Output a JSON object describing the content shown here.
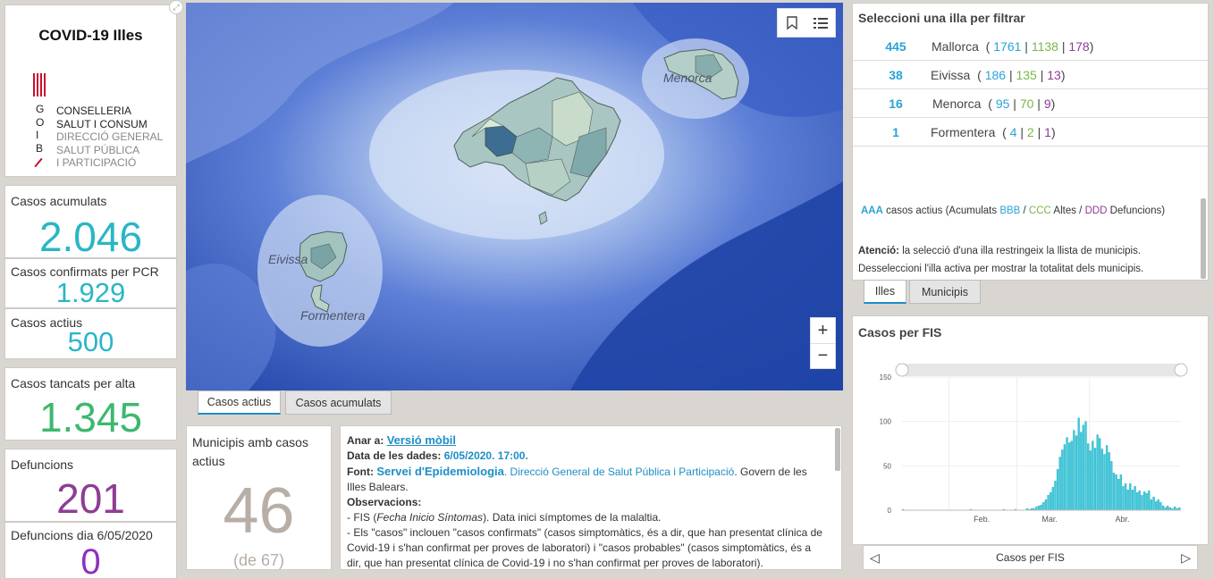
{
  "logo": {
    "title": "COVID-19 Illes",
    "letters": [
      "G",
      "O",
      "I",
      "B"
    ],
    "lines": [
      "CONSELLERIA",
      "SALUT I CONSUM",
      "DIRECCIÓ GENERAL",
      "SALUT PÚBLICA",
      "I PARTICIPACIÓ"
    ]
  },
  "kpis": {
    "acumulats": {
      "label": "Casos acumulats",
      "value": "2.046",
      "color": "#29b6c6"
    },
    "pcr": {
      "label": "Casos confirmats per PCR",
      "value": "1.929",
      "color": "#29b6c6"
    },
    "actius": {
      "label": "Casos actius",
      "value": "500",
      "color": "#29b6c6"
    },
    "alta": {
      "label": "Casos tancats per alta",
      "value": "1.345",
      "color": "#3db86e"
    },
    "defuncions": {
      "label": "Defuncions",
      "value": "201",
      "color": "#8e3d94"
    },
    "defuncions_dia": {
      "label": "Defuncions dia 6/05/2020",
      "value": "0",
      "color": "#8e2fc1"
    }
  },
  "map": {
    "labels": {
      "menorca": "Menorca",
      "eivissa": "Eivissa",
      "formentera": "Formentera"
    },
    "tools": {
      "bookmark_icon": "bookmark-icon",
      "legend_icon": "legend-list-icon"
    },
    "zoom_in": "+",
    "zoom_out": "−"
  },
  "map_tabs": {
    "active": "Casos actius",
    "inactive": "Casos acumulats"
  },
  "municipis": {
    "title": "Municipis amb casos actius",
    "value": "46",
    "sub": "(de 67)"
  },
  "info": {
    "anar_label": "Anar a:",
    "anar_link": "Versió mòbil",
    "data_label": "Data de les dades:",
    "data_value": "6/05/2020. 17:00.",
    "font_label": "Font:",
    "font_link": "Servei d'Epidemiologia",
    "font_rest_blue": ". Direcció General de Salut Pública i Participació",
    "font_rest": ". Govern de les Illes Balears.",
    "obs_label": "Observacions:",
    "obs_1a": "- FIS (",
    "obs_1b": "Fecha Inicio Síntomas",
    "obs_1c": "). Data inici símptomes de la malaltia.",
    "obs_2": "- Els \"casos\" inclouen \"casos confirmats\" (casos simptomàtics, és a dir, que han presentat clínica de Covid-19 i s'han confirmat per proves de laboratori) i \"casos probables\" (casos simptomàtics, és a dir, que han presentat clínica de Covid-19 i no s'han confirmat per proves de laboratori)."
  },
  "illes": {
    "title": "Seleccioni una illa per filtrar",
    "rows": [
      {
        "actius": "445",
        "name": "Mallorca",
        "acum": "1761",
        "altes": "1138",
        "def": "178"
      },
      {
        "actius": "38",
        "name": "Eivissa",
        "acum": "186",
        "altes": "135",
        "def": "13"
      },
      {
        "actius": "16",
        "name": "Menorca",
        "acum": "95",
        "altes": "70",
        "def": "9"
      },
      {
        "actius": "1",
        "name": "Formentera",
        "acum": "4",
        "altes": "2",
        "def": "1"
      }
    ],
    "legend": {
      "aaa": "AAA",
      "t1": " casos actius (Acumulats ",
      "bbb": "BBB",
      "t2": " / ",
      "ccc": "CCC",
      "t3": " Altes / ",
      "ddd": "DDD",
      "t4": " Defuncions)"
    },
    "atencio_label": "Atenció:",
    "atencio_text": " la selecció d'una illa restringeix la llista de municipis.",
    "atencio_text2": "Desseleccioni l'illa activa per mostrar la totalitat dels municipis."
  },
  "list_tabs": {
    "active": "Illes",
    "inactive": "Municipis"
  },
  "fis": {
    "title": "Casos per FIS",
    "footer": "Casos per FIS"
  },
  "chart_data": {
    "type": "bar",
    "title": "Casos per FIS",
    "ylim": [
      0,
      150
    ],
    "yticks": [
      0,
      50,
      100,
      150
    ],
    "xticks": [
      "Feb.",
      "Mar.",
      "Abr."
    ],
    "x_start": "2020-01-12",
    "color": "#3ec9dc",
    "values": [
      1,
      0,
      0,
      0,
      0,
      0,
      0,
      0,
      0,
      0,
      0,
      0,
      0,
      0,
      0,
      0,
      0,
      0,
      0,
      0,
      0,
      0,
      0,
      0,
      0,
      0,
      0,
      0,
      0,
      1,
      0,
      0,
      0,
      0,
      0,
      0,
      0,
      0,
      0,
      0,
      0,
      0,
      0,
      1,
      0,
      0,
      0,
      0,
      1,
      0,
      0,
      0,
      0,
      2,
      1,
      2,
      2,
      4,
      5,
      6,
      9,
      12,
      17,
      20,
      26,
      33,
      46,
      60,
      68,
      74,
      82,
      76,
      78,
      90,
      84,
      104,
      88,
      96,
      100,
      75,
      67,
      78,
      70,
      85,
      81,
      69,
      63,
      73,
      65,
      55,
      42,
      40,
      35,
      40,
      27,
      30,
      23,
      30,
      23,
      27,
      20,
      22,
      17,
      21,
      19,
      22,
      12,
      15,
      10,
      12,
      9,
      5,
      3,
      5,
      3,
      2,
      4,
      2,
      3
    ]
  }
}
